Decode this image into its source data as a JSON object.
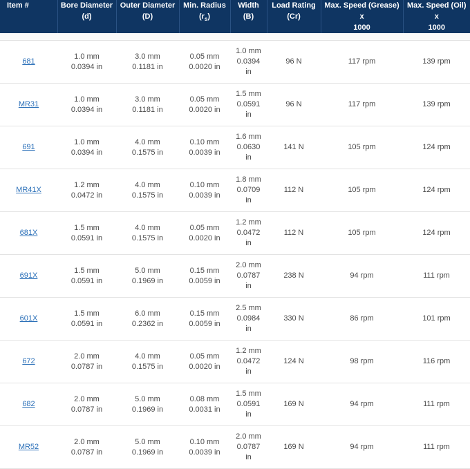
{
  "headers": [
    {
      "line1": "Item #",
      "line2": ""
    },
    {
      "line1": "Bore Diameter",
      "line2": "(d)"
    },
    {
      "line1": "Outer Diameter",
      "line2": "(D)"
    },
    {
      "line1": "Min. Radius",
      "line2_pre": "(r",
      "line2_sub": "s",
      "line2_post": ")"
    },
    {
      "line1": "Width (B)",
      "line2": ""
    },
    {
      "line1": "Load Rating",
      "line2": "(Cr)"
    },
    {
      "line1": "Max. Speed (Grease) x",
      "line2": "1000"
    },
    {
      "line1": "Max. Speed (Oil) x",
      "line2": "1000"
    }
  ],
  "rows": [
    {
      "item": "681",
      "bore_mm": "1.0 mm",
      "bore_in": "0.0394 in",
      "outer_mm": "3.0 mm",
      "outer_in": "0.1181 in",
      "radius_mm": "0.05 mm",
      "radius_in": "0.0020 in",
      "width_mm": "1.0 mm",
      "width_in": "0.0394",
      "width_unit": "in",
      "load": "96 N",
      "grease": "117 rpm",
      "oil": "139 rpm"
    },
    {
      "item": "MR31",
      "bore_mm": "1.0 mm",
      "bore_in": "0.0394 in",
      "outer_mm": "3.0 mm",
      "outer_in": "0.1181 in",
      "radius_mm": "0.05 mm",
      "radius_in": "0.0020 in",
      "width_mm": "1.5 mm",
      "width_in": "0.0591",
      "width_unit": "in",
      "load": "96 N",
      "grease": "117 rpm",
      "oil": "139 rpm"
    },
    {
      "item": "691",
      "bore_mm": "1.0 mm",
      "bore_in": "0.0394 in",
      "outer_mm": "4.0 mm",
      "outer_in": "0.1575 in",
      "radius_mm": "0.10 mm",
      "radius_in": "0.0039 in",
      "width_mm": "1.6 mm",
      "width_in": "0.0630",
      "width_unit": "in",
      "load": "141 N",
      "grease": "105 rpm",
      "oil": "124 rpm"
    },
    {
      "item": "MR41X",
      "bore_mm": "1.2 mm",
      "bore_in": "0.0472 in",
      "outer_mm": "4.0 mm",
      "outer_in": "0.1575 in",
      "radius_mm": "0.10 mm",
      "radius_in": "0.0039 in",
      "width_mm": "1.8 mm",
      "width_in": "0.0709",
      "width_unit": "in",
      "load": "112 N",
      "grease": "105 rpm",
      "oil": "124 rpm"
    },
    {
      "item": "681X",
      "bore_mm": "1.5 mm",
      "bore_in": "0.0591 in",
      "outer_mm": "4.0 mm",
      "outer_in": "0.1575 in",
      "radius_mm": "0.05 mm",
      "radius_in": "0.0020 in",
      "width_mm": "1.2 mm",
      "width_in": "0.0472",
      "width_unit": "in",
      "load": "112 N",
      "grease": "105 rpm",
      "oil": "124 rpm"
    },
    {
      "item": "691X",
      "bore_mm": "1.5 mm",
      "bore_in": "0.0591 in",
      "outer_mm": "5.0 mm",
      "outer_in": "0.1969 in",
      "radius_mm": "0.15 mm",
      "radius_in": "0.0059 in",
      "width_mm": "2.0 mm",
      "width_in": "0.0787",
      "width_unit": "in",
      "load": "238 N",
      "grease": "94 rpm",
      "oil": "111 rpm"
    },
    {
      "item": "601X",
      "bore_mm": "1.5 mm",
      "bore_in": "0.0591 in",
      "outer_mm": "6.0 mm",
      "outer_in": "0.2362 in",
      "radius_mm": "0.15 mm",
      "radius_in": "0.0059 in",
      "width_mm": "2.5 mm",
      "width_in": "0.0984",
      "width_unit": "in",
      "load": "330 N",
      "grease": "86 rpm",
      "oil": "101 rpm"
    },
    {
      "item": "672",
      "bore_mm": "2.0 mm",
      "bore_in": "0.0787 in",
      "outer_mm": "4.0 mm",
      "outer_in": "0.1575 in",
      "radius_mm": "0.05 mm",
      "radius_in": "0.0020 in",
      "width_mm": "1.2 mm",
      "width_in": "0.0472",
      "width_unit": "in",
      "load": "124 N",
      "grease": "98 rpm",
      "oil": "116 rpm"
    },
    {
      "item": "682",
      "bore_mm": "2.0 mm",
      "bore_in": "0.0787 in",
      "outer_mm": "5.0 mm",
      "outer_in": "0.1969 in",
      "radius_mm": "0.08 mm",
      "radius_in": "0.0031 in",
      "width_mm": "1.5 mm",
      "width_in": "0.0591",
      "width_unit": "in",
      "load": "169 N",
      "grease": "94 rpm",
      "oil": "111 rpm"
    },
    {
      "item": "MR52",
      "bore_mm": "2.0 mm",
      "bore_in": "0.0787 in",
      "outer_mm": "5.0 mm",
      "outer_in": "0.1969 in",
      "radius_mm": "0.10 mm",
      "radius_in": "0.0039 in",
      "width_mm": "2.0 mm",
      "width_in": "0.0787",
      "width_unit": "in",
      "load": "169 N",
      "grease": "94 rpm",
      "oil": "111 rpm"
    }
  ],
  "colors": {
    "header_bg": "#0f3562",
    "link": "#2a6fb8",
    "row_border": "#e3e3e3"
  }
}
